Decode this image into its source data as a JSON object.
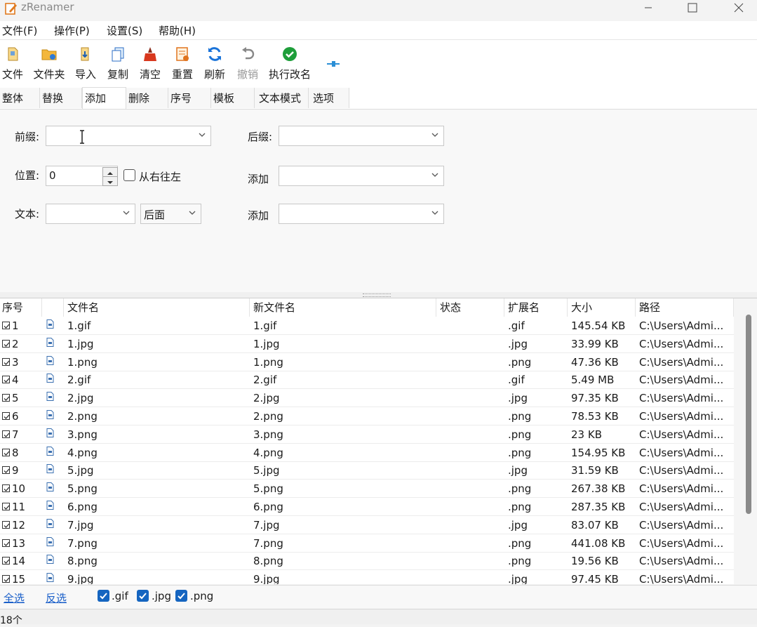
{
  "app": {
    "title": "zRenamer"
  },
  "menu": [
    "文件(F)",
    "操作(P)",
    "设置(S)",
    "帮助(H)"
  ],
  "toolbar": [
    "文件",
    "文件夹",
    "导入",
    "复制",
    "清空",
    "重置",
    "刷新",
    "撤销",
    "执行改名"
  ],
  "tabs": [
    "整体",
    "替换",
    "添加",
    "删除",
    "序号",
    "模板",
    "文本模式",
    "选项"
  ],
  "active_tab": "添加",
  "panel": {
    "prefix_label": "前缀:",
    "suffix_label": "后缀:",
    "position_label": "位置:",
    "position_value": "0",
    "rtl_label": "从右往左",
    "add_label_1": "添加",
    "text_label": "文本:",
    "position_select": "后面",
    "add_label_2": "添加"
  },
  "table": {
    "headers": [
      "序号",
      "",
      "文件名",
      "新文件名",
      "状态",
      "扩展名",
      "大小",
      "路径"
    ],
    "rows": [
      [
        "1",
        "1.gif",
        "1.gif",
        "",
        ".gif",
        "145.54 KB",
        "C:\\Users\\Admi..."
      ],
      [
        "2",
        "1.jpg",
        "1.jpg",
        "",
        ".jpg",
        "33.99 KB",
        "C:\\Users\\Admi..."
      ],
      [
        "3",
        "1.png",
        "1.png",
        "",
        ".png",
        "47.36 KB",
        "C:\\Users\\Admi..."
      ],
      [
        "4",
        "2.gif",
        "2.gif",
        "",
        ".gif",
        "5.49 MB",
        "C:\\Users\\Admi..."
      ],
      [
        "5",
        "2.jpg",
        "2.jpg",
        "",
        ".jpg",
        "97.35 KB",
        "C:\\Users\\Admi..."
      ],
      [
        "6",
        "2.png",
        "2.png",
        "",
        ".png",
        "78.53 KB",
        "C:\\Users\\Admi..."
      ],
      [
        "7",
        "3.png",
        "3.png",
        "",
        ".png",
        "23 KB",
        "C:\\Users\\Admi..."
      ],
      [
        "8",
        "4.png",
        "4.png",
        "",
        ".png",
        "154.95 KB",
        "C:\\Users\\Admi..."
      ],
      [
        "9",
        "5.jpg",
        "5.jpg",
        "",
        ".jpg",
        "31.59 KB",
        "C:\\Users\\Admi..."
      ],
      [
        "10",
        "5.png",
        "5.png",
        "",
        ".png",
        "267.38 KB",
        "C:\\Users\\Admi..."
      ],
      [
        "11",
        "6.png",
        "6.png",
        "",
        ".png",
        "287.35 KB",
        "C:\\Users\\Admi..."
      ],
      [
        "12",
        "7.jpg",
        "7.jpg",
        "",
        ".jpg",
        "83.07 KB",
        "C:\\Users\\Admi..."
      ],
      [
        "13",
        "7.png",
        "7.png",
        "",
        ".png",
        "441.08 KB",
        "C:\\Users\\Admi..."
      ],
      [
        "14",
        "8.png",
        "8.png",
        "",
        ".png",
        "19.56 KB",
        "C:\\Users\\Admi..."
      ],
      [
        "15",
        "9.jpg",
        "9.jpg",
        "",
        ".jpg",
        "97.45 KB",
        "C:\\Users\\Admi..."
      ]
    ]
  },
  "footer": {
    "select_all": "全选",
    "invert": "反选",
    "filters": [
      ".gif",
      ".jpg",
      ".png"
    ]
  },
  "status": "18个",
  "colors": {
    "accent": "#1565c0",
    "link": "#1a5fc9"
  }
}
